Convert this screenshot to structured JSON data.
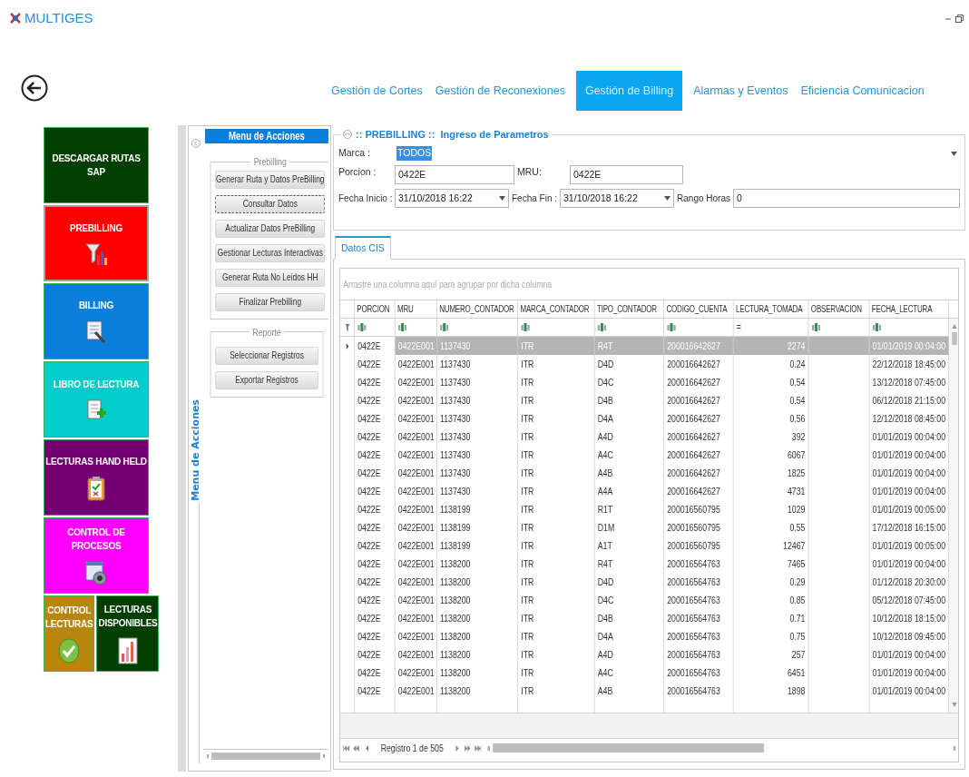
{
  "window": {
    "title": "MULTIGES"
  },
  "nav_tabs": [
    {
      "label": "Gestión de Cortes",
      "selected": false
    },
    {
      "label": "Gestión de Reconexiones",
      "selected": false
    },
    {
      "label": "Gestión de Billing",
      "selected": true
    },
    {
      "label": "Alarmas y Eventos",
      "selected": false
    },
    {
      "label": "Eficiencia Comunicacion",
      "selected": false
    }
  ],
  "sidebar": {
    "rows": [
      {
        "tiles": [
          {
            "label": "DESCARGAR RUTAS SAP",
            "color": "#003f00",
            "kind": "plain",
            "selected": false
          }
        ]
      },
      {
        "tiles": [
          {
            "label": "PREBILLING",
            "color": "#ff0000",
            "kind": "funnel",
            "selected": true
          }
        ]
      },
      {
        "tiles": [
          {
            "label": "BILLING",
            "color": "#0a7fd9",
            "kind": "sheet",
            "selected": false
          }
        ]
      },
      {
        "tiles": [
          {
            "label": "LIBRO DE LECTURA",
            "color": "#00cccc",
            "kind": "addpage",
            "selected": false
          }
        ]
      },
      {
        "tiles": [
          {
            "label": "LECTURAS HAND HELD",
            "color": "#740074",
            "kind": "clipboard",
            "selected": false
          }
        ]
      },
      {
        "tiles": [
          {
            "label": "CONTROL DE PROCESOS",
            "color": "#ff00ff",
            "kind": "window",
            "selected": false
          }
        ]
      },
      {
        "tiles": [
          {
            "label": "CONTROL LECTURAS",
            "color": "#b8860b",
            "kind": "check",
            "selected": false
          },
          {
            "label": "LECTURAS DISPONIBLES",
            "color": "#003f00",
            "kind": "bars",
            "selected": false
          }
        ]
      }
    ]
  },
  "menu": {
    "title": "Menu de Acciones",
    "side_label": "Menu de Acciones",
    "groups": [
      {
        "title": "Prebilling",
        "buttons": [
          {
            "label": "Generar Ruta y Datos PreBilling",
            "focused": false
          },
          {
            "label": "Consultar Datos",
            "focused": true
          },
          {
            "label": "Actualizar Datos PreBilling",
            "focused": false
          },
          {
            "label": "Gestionar Lecturas Interactivas",
            "focused": false
          },
          {
            "label": "Generar Ruta No Leidos HH",
            "focused": false
          },
          {
            "label": "Finalizar Prebilling",
            "focused": false
          }
        ]
      },
      {
        "title": "Reporte",
        "buttons": [
          {
            "label": "Seleccionar Registros",
            "focused": false
          },
          {
            "label": "Exportar Registros",
            "focused": false
          }
        ]
      }
    ]
  },
  "params": {
    "title": ":: PREBILLING ::  Ingreso de Parametros",
    "marca": {
      "label": "Marca :",
      "value": "TODOS"
    },
    "porcion": {
      "label": "Porcion :",
      "value": "0422E"
    },
    "mru": {
      "label": "MRU:",
      "value": "0422E"
    },
    "fecha_inicio": {
      "label": "Fecha Inicio :",
      "value": "31/10/2018 16:22"
    },
    "fecha_fin": {
      "label": "Fecha Fin :",
      "value": "31/10/2018 16:22"
    },
    "rango_horas": {
      "label": "Rango Horas",
      "value": "0"
    }
  },
  "data_tabs": [
    {
      "label": "Datos CIS",
      "selected": true
    }
  ],
  "grid": {
    "group_hint": "Arrastre una columna aquí para agrupar por dicha columna",
    "columns": [
      {
        "label": "PORCION",
        "numeric": false
      },
      {
        "label": "MRU",
        "numeric": false
      },
      {
        "label": "NUMERO_CONTADOR",
        "numeric": false
      },
      {
        "label": "MARCA_CONTADOR",
        "numeric": false
      },
      {
        "label": "TIPO_CONTADOR",
        "numeric": false
      },
      {
        "label": "CODIGO_CUENTA",
        "numeric": false
      },
      {
        "label": "LECTURA_TOMADA",
        "numeric": true
      },
      {
        "label": "OBSERVACION",
        "numeric": false
      },
      {
        "label": "FECHA_LECTURA",
        "numeric": false
      }
    ],
    "filters": [
      {
        "kind": "text"
      },
      {
        "kind": "text"
      },
      {
        "kind": "text"
      },
      {
        "kind": "text"
      },
      {
        "kind": "text"
      },
      {
        "kind": "text"
      },
      {
        "kind": "symbol",
        "symbol": "="
      },
      {
        "kind": "text"
      },
      {
        "kind": "text"
      }
    ],
    "rows": [
      {
        "selected": true,
        "cells": [
          "0422E",
          "0422E001",
          "1137430",
          "ITR",
          "R4T",
          "200016642627",
          "2274",
          null,
          "01/01/2019 00:04:00"
        ]
      },
      {
        "selected": false,
        "cells": [
          "0422E",
          "0422E001",
          "1137430",
          "ITR",
          "D4D",
          "200016642627",
          "0.24",
          null,
          "22/12/2018 18:45:00"
        ]
      },
      {
        "selected": false,
        "cells": [
          "0422E",
          "0422E001",
          "1137430",
          "ITR",
          "D4C",
          "200016642627",
          "0.54",
          null,
          "13/12/2018 07:45:00"
        ]
      },
      {
        "selected": false,
        "cells": [
          "0422E",
          "0422E001",
          "1137430",
          "ITR",
          "D4B",
          "200016642627",
          "0.54",
          null,
          "06/12/2018 21:15:00"
        ]
      },
      {
        "selected": false,
        "cells": [
          "0422E",
          "0422E001",
          "1137430",
          "ITR",
          "D4A",
          "200016642627",
          "0.56",
          null,
          "12/12/2018 08:45:00"
        ]
      },
      {
        "selected": false,
        "cells": [
          "0422E",
          "0422E001",
          "1137430",
          "ITR",
          "A4D",
          "200016642627",
          "392",
          null,
          "01/01/2019 00:04:00"
        ]
      },
      {
        "selected": false,
        "cells": [
          "0422E",
          "0422E001",
          "1137430",
          "ITR",
          "A4C",
          "200016642627",
          "6067",
          null,
          "01/01/2019 00:04:00"
        ]
      },
      {
        "selected": false,
        "cells": [
          "0422E",
          "0422E001",
          "1137430",
          "ITR",
          "A4B",
          "200016642627",
          "1825",
          null,
          "01/01/2019 00:04:00"
        ]
      },
      {
        "selected": false,
        "cells": [
          "0422E",
          "0422E001",
          "1137430",
          "ITR",
          "A4A",
          "200016642627",
          "4731",
          null,
          "01/01/2019 00:04:00"
        ]
      },
      {
        "selected": false,
        "cells": [
          "0422E",
          "0422E001",
          "1138199",
          "ITR",
          "R1T",
          "200016560795",
          "1029",
          null,
          "01/01/2019 00:05:00"
        ]
      },
      {
        "selected": false,
        "cells": [
          "0422E",
          "0422E001",
          "1138199",
          "ITR",
          "D1M",
          "200016560795",
          "0.55",
          null,
          "17/12/2018 16:15:00"
        ]
      },
      {
        "selected": false,
        "cells": [
          "0422E",
          "0422E001",
          "1138199",
          "ITR",
          "A1T",
          "200016560795",
          "12467",
          null,
          "01/01/2019 00:05:00"
        ]
      },
      {
        "selected": false,
        "cells": [
          "0422E",
          "0422E001",
          "1138200",
          "ITR",
          "R4T",
          "200016564763",
          "7465",
          null,
          "01/01/2019 00:04:00"
        ]
      },
      {
        "selected": false,
        "cells": [
          "0422E",
          "0422E001",
          "1138200",
          "ITR",
          "D4D",
          "200016564763",
          "0.29",
          null,
          "01/12/2018 20:30:00"
        ]
      },
      {
        "selected": false,
        "cells": [
          "0422E",
          "0422E001",
          "1138200",
          "ITR",
          "D4C",
          "200016564763",
          "0.85",
          null,
          "05/12/2018 07:45:00"
        ]
      },
      {
        "selected": false,
        "cells": [
          "0422E",
          "0422E001",
          "1138200",
          "ITR",
          "D4B",
          "200016564763",
          "0.71",
          null,
          "10/12/2018 18:15:00"
        ]
      },
      {
        "selected": false,
        "cells": [
          "0422E",
          "0422E001",
          "1138200",
          "ITR",
          "D4A",
          "200016564763",
          "0.75",
          null,
          "10/12/2018 09:45:00"
        ]
      },
      {
        "selected": false,
        "cells": [
          "0422E",
          "0422E001",
          "1138200",
          "ITR",
          "A4D",
          "200016564763",
          "257",
          null,
          "01/01/2019 00:04:00"
        ]
      },
      {
        "selected": false,
        "cells": [
          "0422E",
          "0422E001",
          "1138200",
          "ITR",
          "A4C",
          "200016564763",
          "6451",
          null,
          "01/01/2019 00:04:00"
        ]
      },
      {
        "selected": false,
        "cells": [
          "0422E",
          "0422E001",
          "1138200",
          "ITR",
          "A4B",
          "200016564763",
          "1898",
          null,
          "01/01/2019 00:04:00"
        ]
      }
    ],
    "navigator": {
      "label": "Registro 1 de 505"
    }
  }
}
